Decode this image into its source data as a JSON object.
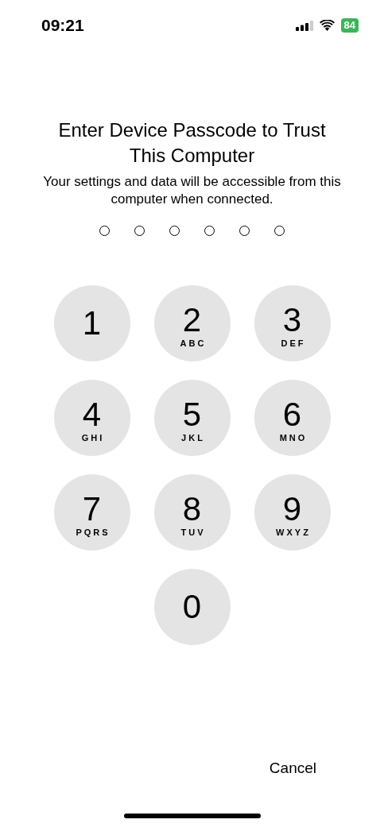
{
  "status_bar": {
    "time": "09:21",
    "battery": "84"
  },
  "title": "Enter Device Passcode to Trust This Computer",
  "subtitle": "Your settings and data will be accessible from this computer when connected.",
  "passcode_dots": [
    {
      "filled": false
    },
    {
      "filled": false
    },
    {
      "filled": false
    },
    {
      "filled": false
    },
    {
      "filled": false
    },
    {
      "filled": false
    }
  ],
  "keys": [
    {
      "digit": "1"
    },
    {
      "digit": "2",
      "letters": "ABC"
    },
    {
      "digit": "3",
      "letters": "DEF"
    },
    {
      "digit": "4",
      "letters": "GHI"
    },
    {
      "digit": "5",
      "letters": "JKL"
    },
    {
      "digit": "6",
      "letters": "MNO"
    },
    {
      "digit": "7",
      "letters": "PQRS"
    },
    {
      "digit": "8",
      "letters": "TUV"
    },
    {
      "digit": "9",
      "letters": "WXYZ"
    },
    {
      "digit": "0"
    }
  ],
  "cancel": "Cancel"
}
